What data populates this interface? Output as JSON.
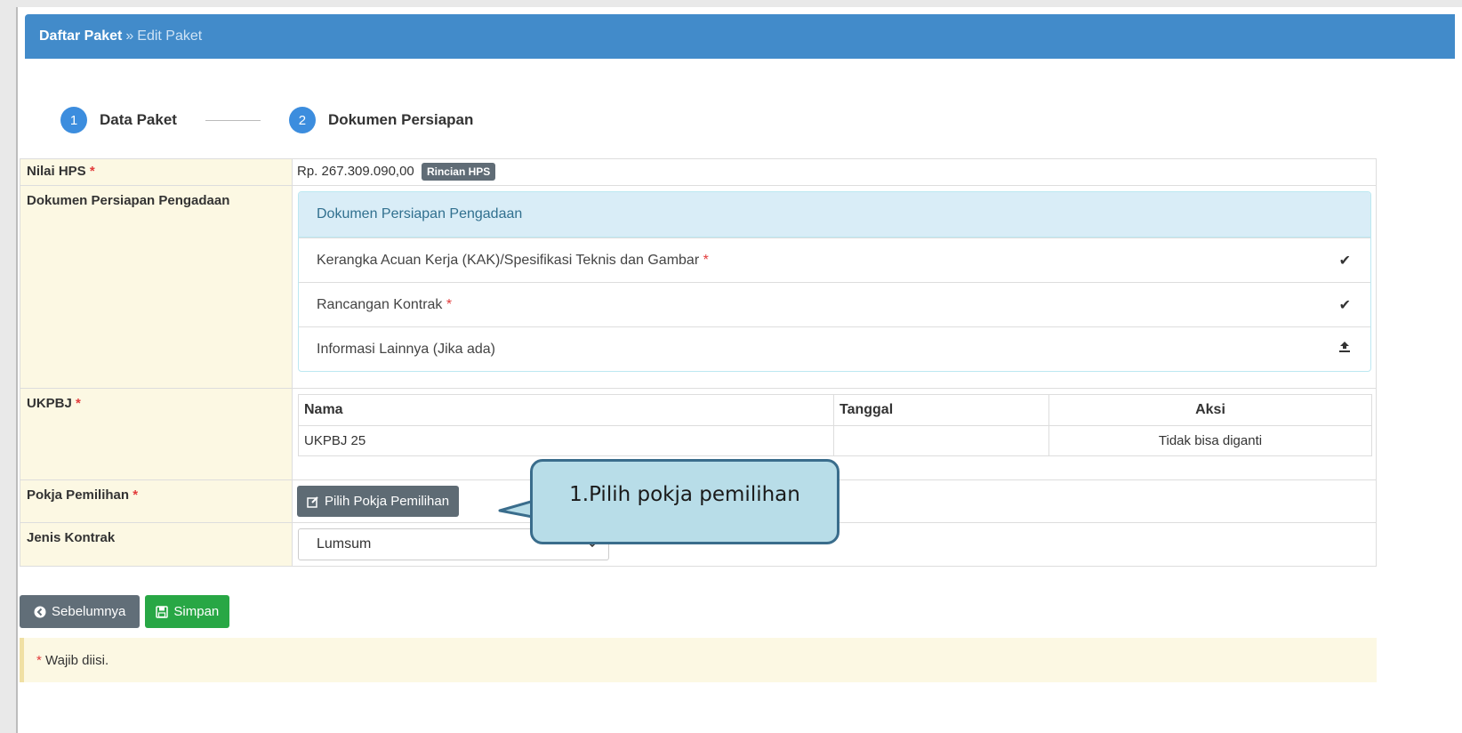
{
  "breadcrumb": {
    "parent": "Daftar Paket",
    "separator": "»",
    "current": "Edit Paket"
  },
  "steps": [
    {
      "number": "1",
      "label": "Data Paket"
    },
    {
      "number": "2",
      "label": "Dokumen Persiapan"
    }
  ],
  "form": {
    "hps": {
      "label": "Nilai HPS",
      "required_mark": "*",
      "value": "Rp. 267.309.090,00",
      "detail_badge": "Rincian HPS"
    },
    "dokumen": {
      "label": "Dokumen Persiapan Pengadaan",
      "panel_title": "Dokumen Persiapan Pengadaan",
      "items": [
        {
          "label": "Kerangka Acuan Kerja (KAK)/Spesifikasi Teknis dan Gambar",
          "required_mark": "*",
          "icon": "check-icon"
        },
        {
          "label": "Rancangan Kontrak",
          "required_mark": "*",
          "icon": "check-icon"
        },
        {
          "label": "Informasi Lainnya (Jika ada)",
          "required_mark": "",
          "icon": "upload-icon"
        }
      ]
    },
    "ukpbj": {
      "label": "UKPBJ",
      "required_mark": "*",
      "columns": [
        "Nama",
        "Tanggal",
        "Aksi"
      ],
      "rows": [
        {
          "nama": "UKPBJ 25",
          "tanggal": "",
          "aksi": "Tidak bisa diganti"
        }
      ]
    },
    "pokja": {
      "label": "Pokja Pemilihan",
      "required_mark": "*",
      "button_label": "Pilih Pokja Pemilihan"
    },
    "jenis_kontrak": {
      "label": "Jenis Kontrak",
      "selected": "Lumsum"
    }
  },
  "actions": {
    "prev_label": "Sebelumnya",
    "save_label": "Simpan"
  },
  "note": {
    "mark": "*",
    "text": "Wajib diisi."
  },
  "callout": {
    "text": "1.Pilih pokja pemilihan"
  },
  "colors": {
    "header": "#428bca",
    "label_bg": "#fcf8e3",
    "panel_head": "#d9edf7",
    "save": "#28a745",
    "callout_bg": "#b8dde8",
    "callout_border": "#3a6d8c"
  }
}
